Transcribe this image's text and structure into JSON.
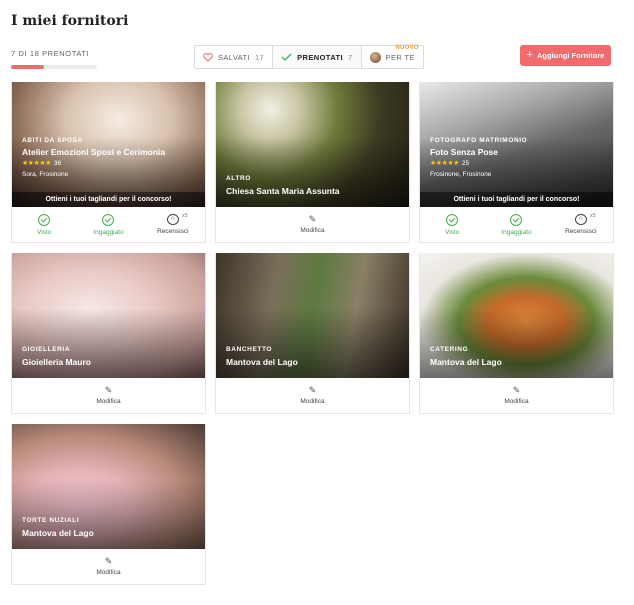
{
  "header": {
    "title": "I miei fornitori",
    "count": "7 DI 18 PRENOTATI",
    "progress": 0.389
  },
  "tabs": [
    {
      "label": "SALVATI",
      "count": "17",
      "icon": "heart-icon"
    },
    {
      "label": "PRENOTATI",
      "count": "7",
      "icon": "check-icon"
    },
    {
      "label": "PER TE",
      "badge": "NUOVO",
      "icon": "avatar"
    }
  ],
  "add_button": {
    "label": "Aggiungi Fornitore"
  },
  "cards": [
    {
      "category": "ABITI DA SPOSA",
      "name": "Atelier Emozioni Sposi e Cerimonia",
      "stars": "★★★★★",
      "reviews": "36",
      "location": "Sora, Frosinone",
      "promo": "Ottieni i tuoi tagliandi per il concorso!",
      "actions": {
        "seen": "Visto",
        "hired": "Ingaggiato",
        "review": "Recensisci",
        "review_count": "x5"
      }
    },
    {
      "category": "ALTRO",
      "name": "Chiesa Santa Maria Assunta",
      "edit": "Modifica"
    },
    {
      "category": "FOTOGRAFO MATRIMONIO",
      "name": "Foto Senza Pose",
      "stars": "★★★★★",
      "reviews": "25",
      "location": "Frosinone, Frosinone",
      "promo": "Ottieni i tuoi tagliandi per il concorso!",
      "actions": {
        "seen": "Visto",
        "hired": "Ingaggiato",
        "review": "Recensisci",
        "review_count": "x5"
      }
    },
    {
      "category": "GIOIELLERIA",
      "name": "Gioielleria Mauro",
      "edit": "Modifica"
    },
    {
      "category": "BANCHETTO",
      "name": "Mantova del Lago",
      "edit": "Modifica"
    },
    {
      "category": "CATERING",
      "name": "Mantova del Lago",
      "edit": "Modifica"
    },
    {
      "category": "TORTE NUZIALI",
      "name": "Mantova del Lago",
      "edit": "Modifica"
    }
  ],
  "colors": {
    "accent": "#ef6b6e",
    "green": "#4aa85a",
    "star": "#f5c518"
  }
}
